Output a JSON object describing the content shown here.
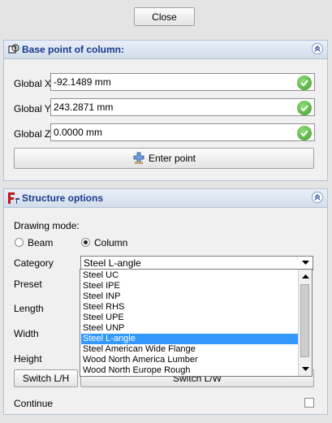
{
  "top": {
    "close_label": "Close"
  },
  "base_point": {
    "title": "Base point of column:",
    "fields": [
      {
        "label": "Global X",
        "value": "-92.1489 mm"
      },
      {
        "label": "Global Y",
        "value": "243.2871 mm"
      },
      {
        "label": "Global Z",
        "value": "0.0000 mm"
      }
    ],
    "enter_point_label": "Enter point"
  },
  "structure": {
    "title": "Structure options",
    "drawing_mode_label": "Drawing mode:",
    "radio_beam": "Beam",
    "radio_column": "Column",
    "selected_mode": "Column",
    "category_label": "Category",
    "category_value": "Steel L-angle",
    "preset_label": "Preset",
    "length_label": "Length",
    "width_label": "Width",
    "height_label": "Height",
    "switch_lh": "Switch L/H",
    "switch_lw": "Switch L/W",
    "continue_label": "Continue",
    "continue_checked": false,
    "dropdown_items": [
      "Steel UC",
      "Steel IPE",
      "Steel INP",
      "Steel RHS",
      "Steel UPE",
      "Steel UNP",
      "Steel L-angle",
      "Steel American Wide Flange",
      "Wood North America Lumber",
      "Wood North Europe Rough"
    ],
    "dropdown_selected_index": 6
  },
  "colors": {
    "panel_title": "#1a3b8c",
    "selection": "#3399ff",
    "check_green": "#3f9a2a"
  }
}
